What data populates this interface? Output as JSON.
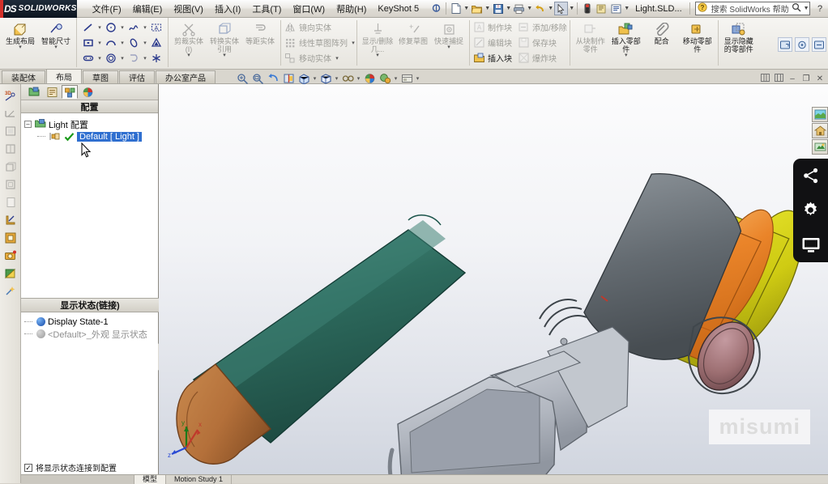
{
  "app": {
    "brand_ds": "DS",
    "brand_name": "SOLIDWORKS",
    "document_name": "Light.SLD...",
    "accent_red": "#d4302a",
    "selection_blue": "#2f6fd0"
  },
  "menu": [
    {
      "label": "文件(F)",
      "name": "menu-file"
    },
    {
      "label": "编辑(E)",
      "name": "menu-edit"
    },
    {
      "label": "视图(V)",
      "name": "menu-view"
    },
    {
      "label": "插入(I)",
      "name": "menu-insert"
    },
    {
      "label": "工具(T)",
      "name": "menu-tools"
    },
    {
      "label": "窗口(W)",
      "name": "menu-window"
    },
    {
      "label": "帮助(H)",
      "name": "menu-help"
    },
    {
      "label": "KeyShot 5",
      "name": "menu-keyshot"
    }
  ],
  "quick_access": {
    "new_icon": "new-document-icon",
    "open_icon": "open-folder-icon",
    "save_icon": "save-icon",
    "print_icon": "print-icon",
    "undo_icon": "undo-icon",
    "select_icon": "select-arrow-icon",
    "rebuild_icon": "rebuild-traffic-light-icon",
    "options_icon": "options-icon",
    "properties_icon": "properties-icon"
  },
  "search": {
    "placeholder": "搜索 SolidWorks 帮助",
    "icon": "search-icon",
    "help_icon": "help-question-icon"
  },
  "window_controls": {
    "minimize": "–",
    "restore": "❐",
    "close": "✕"
  },
  "ribbon": {
    "groups": [
      {
        "name": "layout-group",
        "buttons": [
          {
            "label": "生成布局",
            "icon": "generate-layout-icon",
            "dim": false,
            "dropdown": true
          },
          {
            "label": "智能尺寸",
            "icon": "smart-dimension-icon",
            "dim": false,
            "dropdown": true
          }
        ]
      },
      {
        "name": "sketch-entities-group",
        "rows": [
          [
            "line-icon",
            "circle-icon",
            "spline-icon",
            "text-icon"
          ],
          [
            "rectangle-icon",
            "arc-icon",
            "ellipse-icon",
            "sketch-point-icon"
          ],
          [
            "slot-icon",
            "polygon-icon",
            "fillet-icon",
            "point-star-icon"
          ]
        ]
      },
      {
        "name": "entity-tools-group",
        "buttons": [
          {
            "label": "剪裁实体(I)",
            "icon": "trim-entities-icon",
            "dim": true,
            "dropdown": true
          },
          {
            "label": "转换实体引用",
            "icon": "convert-entities-icon",
            "dim": true,
            "dropdown": true
          },
          {
            "label": "等距实体",
            "icon": "offset-entities-icon",
            "dim": true,
            "dropdown": false
          }
        ]
      },
      {
        "name": "mirror-group",
        "items": [
          {
            "label": "镜向实体",
            "icon": "mirror-entities-icon",
            "dim": true
          },
          {
            "label": "线性草图阵列",
            "icon": "linear-sketch-pattern-icon",
            "dim": true
          },
          {
            "label": "移动实体",
            "icon": "move-entities-icon",
            "dim": true
          }
        ]
      },
      {
        "name": "display-group",
        "buttons": [
          {
            "label": "显示/删除几...",
            "icon": "display-delete-relations-icon",
            "dim": true,
            "dropdown": true
          },
          {
            "label": "修复草图",
            "icon": "repair-sketch-icon",
            "dim": true,
            "dropdown": false
          },
          {
            "label": "快速捕捉",
            "icon": "quick-snaps-icon",
            "dim": true,
            "dropdown": true
          }
        ]
      },
      {
        "name": "blocks-group",
        "items": [
          {
            "label": "制作块",
            "icon": "make-block-icon",
            "dim": true
          },
          {
            "label": "编辑块",
            "icon": "edit-block-icon",
            "dim": true
          },
          {
            "label": "插入块",
            "icon": "insert-block-icon",
            "dim": false
          },
          {
            "label": "添加/移除",
            "icon": "add-remove-icon",
            "dim": true
          },
          {
            "label": "保存块",
            "icon": "save-block-icon",
            "dim": true
          },
          {
            "label": "爆炸块",
            "icon": "explode-block-icon",
            "dim": true
          }
        ]
      },
      {
        "name": "assembly-group",
        "buttons": [
          {
            "label": "从块制作零件",
            "icon": "make-part-from-block-icon",
            "dim": true,
            "dropdown": false
          },
          {
            "label": "插入零部件",
            "icon": "insert-components-icon",
            "dim": false,
            "dropdown": true
          },
          {
            "label": "配合",
            "icon": "mate-paperclip-icon",
            "dim": false,
            "dropdown": false
          },
          {
            "label": "移动零部件",
            "icon": "move-component-icon",
            "dim": false,
            "dropdown": false
          },
          {
            "label": "显示隐藏的零部件",
            "icon": "show-hidden-components-icon",
            "dim": false,
            "dropdown": false
          }
        ]
      }
    ],
    "top_right_buttons": [
      {
        "name": "restore-panel-button",
        "icon": "restore-panel-icon"
      },
      {
        "name": "options-panel-button",
        "icon": "options-panel-icon"
      },
      {
        "name": "expand-panel-button",
        "icon": "expand-panel-icon"
      }
    ]
  },
  "tabs": [
    {
      "label": "装配体",
      "active": false
    },
    {
      "label": "布局",
      "active": true
    },
    {
      "label": "草图",
      "active": false
    },
    {
      "label": "评估",
      "active": false
    },
    {
      "label": "办公室产品",
      "active": false
    }
  ],
  "left_toolbar": [
    {
      "name": "3d-sketch-tool",
      "icon": "3d-sketch-icon",
      "dim": false
    },
    {
      "name": "measure-tool",
      "icon": "measure-icon",
      "dim": true
    },
    {
      "name": "section-view-tool",
      "icon": "section-view-icon",
      "dim": true
    },
    {
      "name": "assembly-feature-tool",
      "icon": "assembly-feature-icon",
      "dim": true
    },
    {
      "name": "reference-geometry-tool",
      "icon": "reference-geometry-icon",
      "dim": true
    },
    {
      "name": "new-part-tool",
      "icon": "new-part-icon",
      "dim": true
    },
    {
      "name": "new-sheet-tool",
      "icon": "new-sheet-icon",
      "dim": true
    },
    {
      "name": "layout-sketch-tool",
      "icon": "layout-sketch-icon",
      "dim": false
    },
    {
      "name": "display-state-tool",
      "icon": "display-state-icon",
      "dim": false
    },
    {
      "name": "appearance-tool",
      "icon": "appearance-camera-icon",
      "dim": false
    },
    {
      "name": "scene-tool",
      "icon": "scene-palette-icon",
      "dim": false
    },
    {
      "name": "render-tools",
      "icon": "render-sparkle-icon",
      "dim": false
    }
  ],
  "feature_manager": {
    "tabs": [
      {
        "name": "feature-tree-tab",
        "icon": "feature-tree-icon",
        "active": false
      },
      {
        "name": "property-manager-tab",
        "icon": "property-manager-icon",
        "active": false
      },
      {
        "name": "configuration-manager-tab",
        "icon": "configuration-manager-icon",
        "active": true
      },
      {
        "name": "display-manager-tab",
        "icon": "display-manager-palette-icon",
        "active": false
      }
    ],
    "header": "配置",
    "tree": {
      "root_label": "Light 配置",
      "root_icon": "configuration-root-icon",
      "expander": "–",
      "child_label": "Default [ Light ]",
      "child_icon": "configuration-icon",
      "check_icon": "green-check-icon",
      "selected": true
    },
    "display_states": {
      "header": "显示状态(链接)",
      "items": [
        {
          "label": "Display State-1",
          "dot": "blue",
          "dim": false
        },
        {
          "label": "<Default>_外观 显示状态",
          "dot": "gray",
          "dim": true
        }
      ]
    },
    "link_checkbox": {
      "label": "将显示状态连接到配置",
      "checked": true,
      "mark": "✓"
    }
  },
  "viewport": {
    "toolbar": [
      {
        "name": "zoom-to-fit-button",
        "icon": "zoom-to-fit-icon",
        "dropdown": false
      },
      {
        "name": "zoom-to-area-button",
        "icon": "zoom-to-area-icon",
        "dropdown": false
      },
      {
        "name": "previous-view-button",
        "icon": "previous-view-icon",
        "dropdown": false
      },
      {
        "name": "section-view-button",
        "icon": "section-view-icon",
        "dropdown": false
      },
      {
        "name": "view-orientation-button",
        "icon": "view-orientation-icon",
        "dropdown": true
      },
      {
        "name": "display-style-button",
        "icon": "display-style-cube-icon",
        "dropdown": true
      },
      {
        "name": "hide-show-items-button",
        "icon": "hide-show-glasses-icon",
        "dropdown": true
      },
      {
        "name": "edit-appearance-button",
        "icon": "edit-appearance-sphere-icon",
        "dropdown": false
      },
      {
        "name": "apply-scene-button",
        "icon": "apply-scene-icon",
        "dropdown": true
      },
      {
        "name": "view-settings-button",
        "icon": "view-settings-icon",
        "dropdown": true
      }
    ],
    "window_buttons": [
      {
        "name": "tile-horizontal-button",
        "icon": "tile-horizontal-icon"
      },
      {
        "name": "tile-vertical-button",
        "icon": "tile-vertical-icon"
      },
      {
        "name": "minimize-doc-button",
        "icon": "minimize-icon"
      },
      {
        "name": "restore-doc-button",
        "icon": "restore-icon"
      },
      {
        "name": "close-doc-button",
        "icon": "close-icon"
      }
    ],
    "watermark": "misumi",
    "triad": {
      "x": "x",
      "y": "y",
      "z": "z"
    },
    "model_colors": {
      "body_green": "#2f6f62",
      "cap_brown": "#b4703a",
      "lens_orange": "#e8812a",
      "ring_yellow": "#d8d419",
      "housing_gray": "#6e7478",
      "screen_silver": "#b8bcc4",
      "lens_glass": "#9d6f72"
    }
  },
  "right_panel": {
    "tabs": [
      {
        "name": "appearances-tab",
        "icon": "appearances-icon"
      },
      {
        "name": "scenes-tab",
        "icon": "scenes-house-icon"
      },
      {
        "name": "decals-tab",
        "icon": "decals-icon"
      }
    ],
    "flyout": [
      {
        "name": "share-button",
        "icon": "share-icon"
      },
      {
        "name": "settings-button",
        "icon": "gear-icon"
      },
      {
        "name": "display-button",
        "icon": "monitor-icon"
      }
    ]
  },
  "bottom_tabs": [
    {
      "label": "模型",
      "active": true
    },
    {
      "label": "Motion Study 1",
      "active": false
    }
  ]
}
